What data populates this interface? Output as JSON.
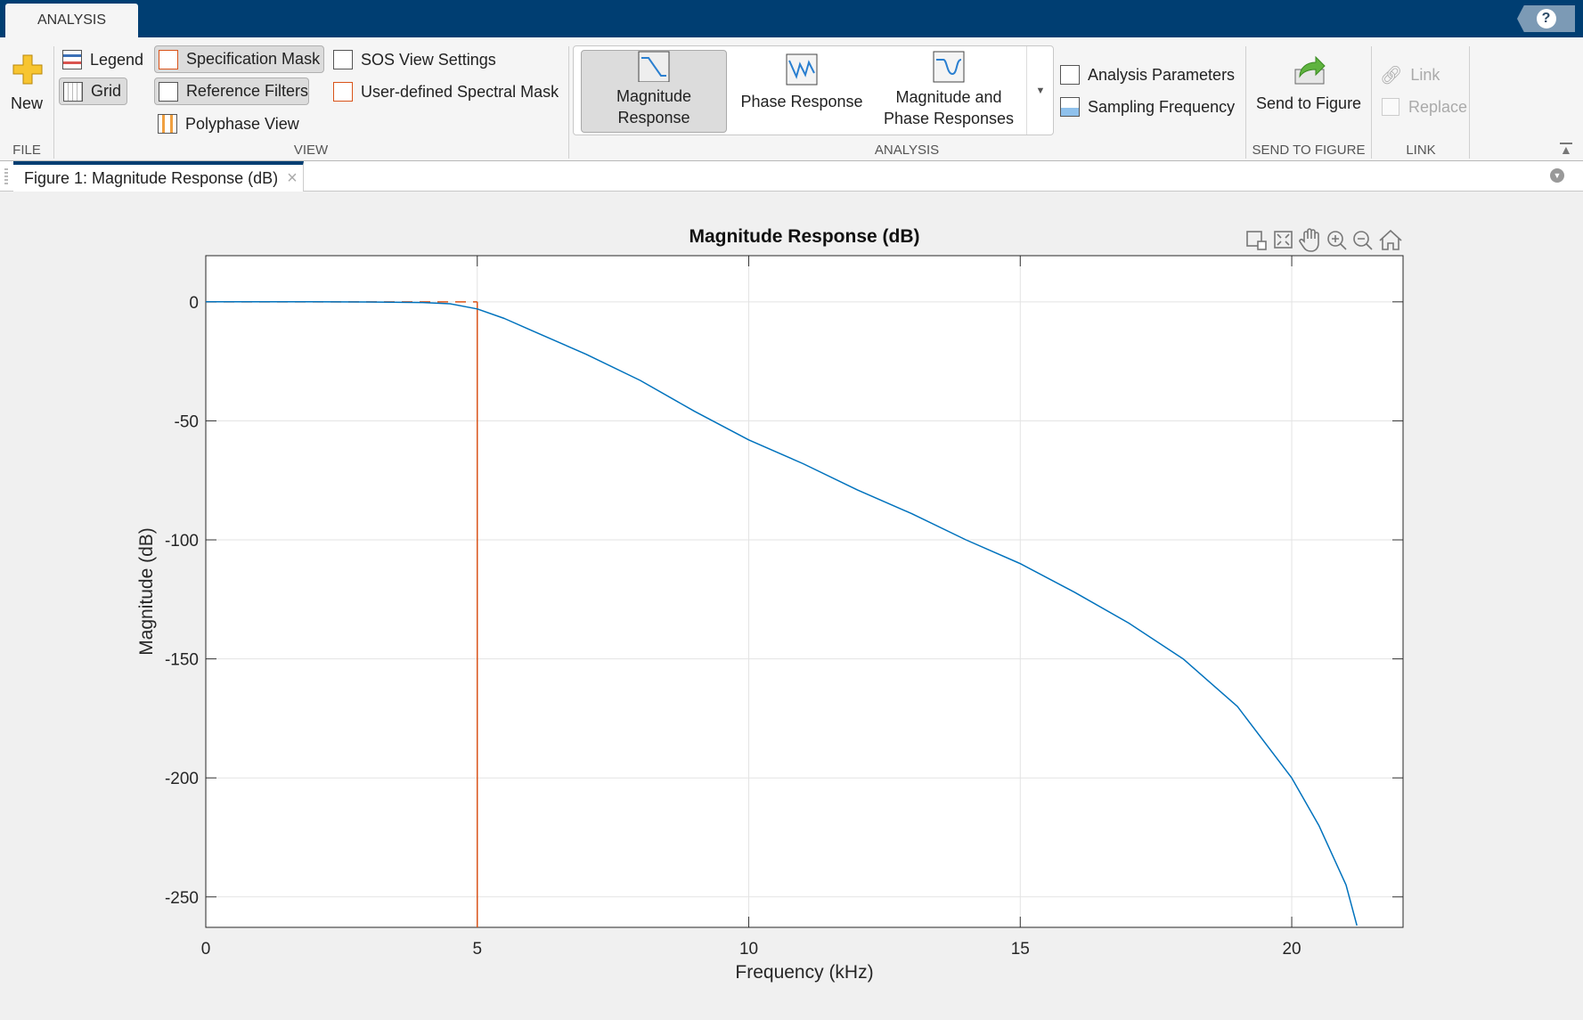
{
  "header": {
    "tab": "ANALYSIS",
    "help_icon": "help-icon"
  },
  "file": {
    "new_label": "New",
    "group": "FILE"
  },
  "view": {
    "legend": "Legend",
    "grid": "Grid",
    "spec_mask": "Specification Mask",
    "ref_filters": "Reference Filters",
    "polyphase": "Polyphase View",
    "sos": "SOS View Settings",
    "user_mask": "User-defined Spectral Mask",
    "group": "VIEW"
  },
  "analysis": {
    "items": [
      {
        "l1": "Magnitude",
        "l2": "Response",
        "selected": true
      },
      {
        "l1": "Phase Response",
        "l2": "",
        "selected": false
      },
      {
        "l1": "Magnitude and",
        "l2": "Phase Responses",
        "selected": false
      }
    ],
    "params": "Analysis Parameters",
    "fs": "Sampling Frequency",
    "group": "ANALYSIS"
  },
  "send": {
    "label": "Send to Figure",
    "group": "SEND TO FIGURE"
  },
  "link": {
    "link": "Link",
    "replace": "Replace",
    "replace_checked": false,
    "group": "LINK"
  },
  "figure_tab": {
    "label": "Figure 1: Magnitude Response (dB)",
    "close": "×"
  },
  "colors": {
    "accent": "#003e72",
    "curve": "#0072bd",
    "mask": "#d95319"
  },
  "chart_data": {
    "type": "line",
    "title": "Magnitude Response (dB)",
    "xlabel": "Frequency (kHz)",
    "ylabel": "Magnitude (dB)",
    "xlim": [
      0,
      22.05
    ],
    "ylim": [
      -262.8,
      19.4
    ],
    "xticks": [
      0,
      5,
      10,
      15,
      20
    ],
    "yticks": [
      0,
      -50,
      -100,
      -150,
      -200,
      -250
    ],
    "grid": true,
    "series": [
      {
        "x": [
          0,
          1,
          2,
          3,
          4,
          4.5,
          5,
          5.5,
          6,
          7,
          8,
          9,
          10,
          11,
          12,
          13,
          14,
          15,
          16,
          17,
          18,
          19,
          20,
          20.5,
          21,
          21.2
        ],
        "y": [
          0,
          0,
          0,
          -0.05,
          -0.3,
          -0.8,
          -3,
          -7,
          -12,
          -22,
          -33,
          -46,
          -58,
          -68,
          -79,
          -89,
          -100,
          -110,
          -122,
          -135,
          -150,
          -170,
          -200,
          -220,
          -245,
          -262
        ]
      }
    ],
    "mask": {
      "passband_edge": 5,
      "passband_level": 0
    }
  }
}
